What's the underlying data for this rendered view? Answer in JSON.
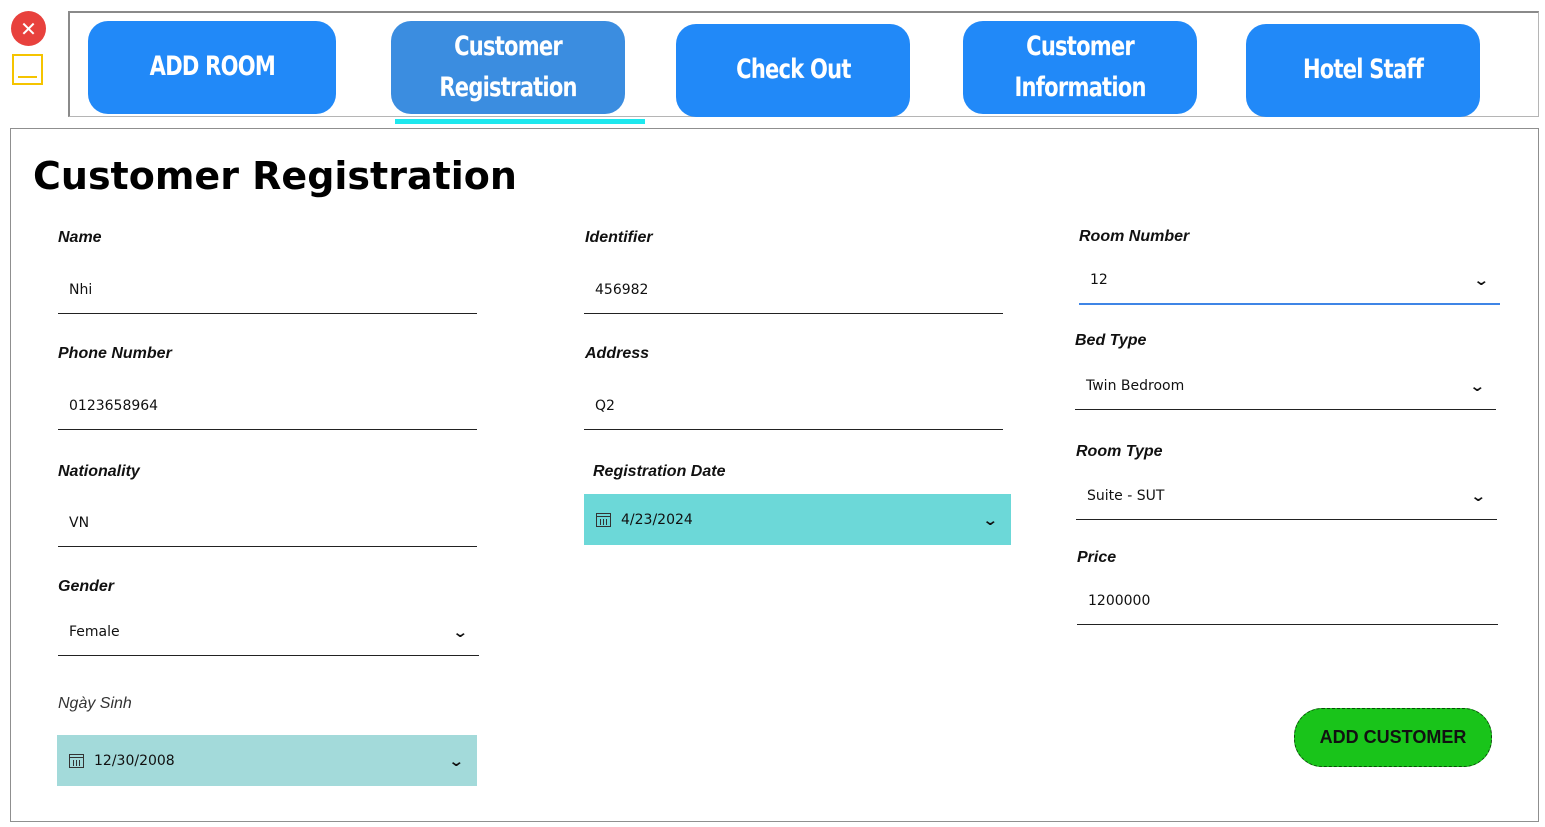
{
  "window": {
    "close_icon": "close-icon",
    "close_glyph": "✕",
    "minimize_icon": "minimize-icon"
  },
  "nav": {
    "tabs": [
      {
        "label": "ADD ROOM"
      },
      {
        "label": "Customer\nRegistration",
        "active": true
      },
      {
        "label": "Check Out"
      },
      {
        "label": "Customer\nInformation"
      },
      {
        "label": "Hotel Staff"
      }
    ],
    "colors": {
      "button": "#2189f8",
      "active_button": "#3b8de0",
      "underline": "#1ee8ee"
    }
  },
  "page": {
    "title": "Customer Registration"
  },
  "form": {
    "name": {
      "label": "Name",
      "value": "Nhi"
    },
    "phone": {
      "label": "Phone Number",
      "value": "0123658964"
    },
    "nationality": {
      "label": "Nationality",
      "value": "VN"
    },
    "gender": {
      "label": "Gender",
      "value": "Female"
    },
    "birth_date": {
      "label": "Ngày Sinh",
      "value": "12/30/2008",
      "bg": "#a3dada"
    },
    "identifier": {
      "label": "Identifier",
      "value": "456982"
    },
    "address": {
      "label": "Address",
      "value": "Q2"
    },
    "registration_date": {
      "label": "Registration Date",
      "value": "4/23/2024",
      "bg": "#6cd8d8"
    },
    "room_number": {
      "label": "Room Number",
      "value": "12"
    },
    "bed_type": {
      "label": "Bed Type",
      "value": "Twin Bedroom"
    },
    "room_type": {
      "label": "Room Type",
      "value": "Suite - SUT"
    },
    "price": {
      "label": "Price",
      "value": "1200000"
    },
    "dropdown_glyph": "⌄",
    "submit_label": "ADD CUSTOMER",
    "submit_color": "#19c41a"
  }
}
